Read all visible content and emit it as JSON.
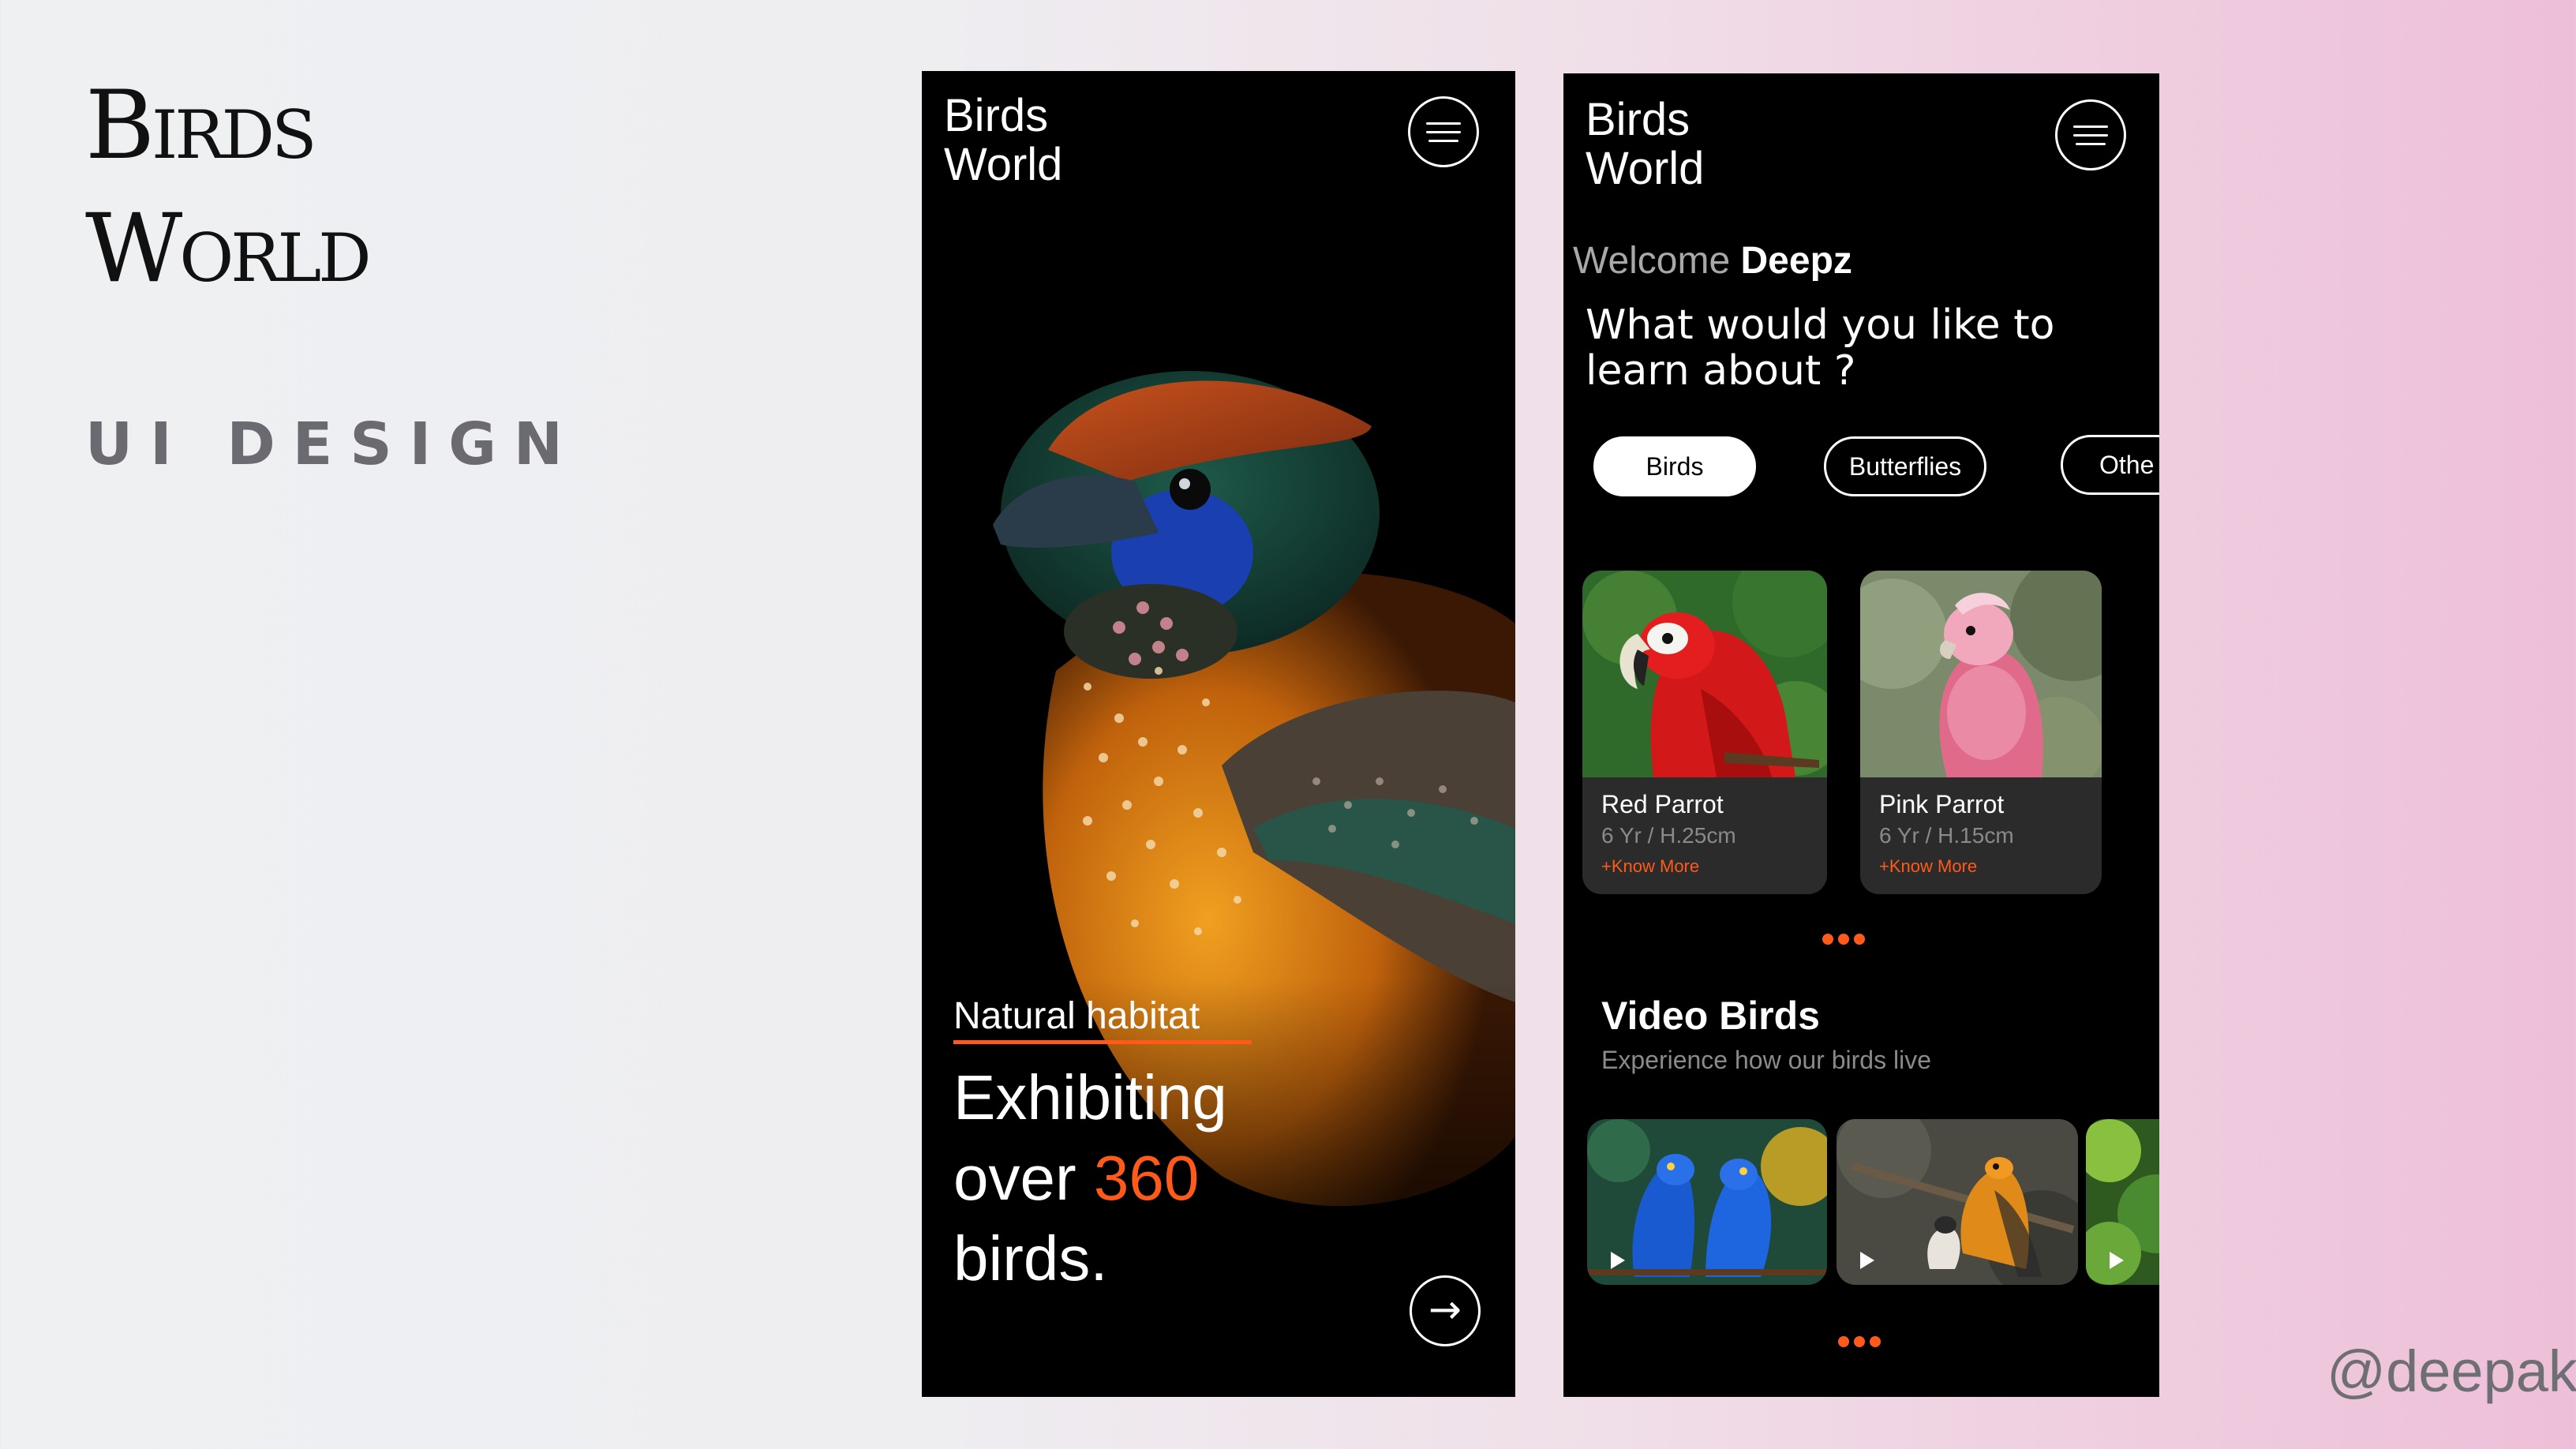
{
  "slide": {
    "title_line1": "Birds",
    "title_line2": "World",
    "subtitle": "UI DESIGN",
    "watermark": "@deepak"
  },
  "screen1": {
    "app_title_line1": "Birds",
    "app_title_line2": "World",
    "menu_icon": "hamburger-icon",
    "habitat_label": "Natural habitat",
    "hero_line1": "Exhibiting",
    "hero_line2_pre": "over",
    "hero_number": "360",
    "hero_line3": "birds.",
    "next_icon": "arrow-right-icon",
    "accent_color": "#ff5a1a"
  },
  "screen2": {
    "app_title_line1": "Birds",
    "app_title_line2": "World",
    "menu_icon": "hamburger-icon",
    "welcome_label": "Welcome",
    "user_name": "Deepz",
    "question": "What would you like to learn about ?",
    "categories": [
      {
        "label": "Birds",
        "active": true
      },
      {
        "label": "Butterflies",
        "active": false
      },
      {
        "label": "Othe",
        "active": false
      }
    ],
    "cards": [
      {
        "name": "Red Parrot",
        "meta": "6 Yr / H.25cm",
        "link": "+Know More"
      },
      {
        "name": "Pink Parrot",
        "meta": "6 Yr / H.15cm",
        "link": "+Know More"
      }
    ],
    "video_section": {
      "title": "Video Birds",
      "subtitle": "Experience how our birds live"
    }
  }
}
